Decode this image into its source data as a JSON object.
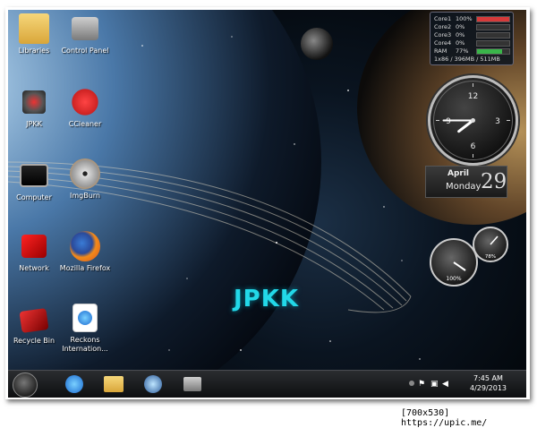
{
  "desktop_icons": [
    {
      "label": "Libraries",
      "icon": "folder-icon"
    },
    {
      "label": "Control Panel",
      "icon": "control-panel-icon"
    },
    {
      "label": "JPKK",
      "icon": "jpkk-app-icon"
    },
    {
      "label": "CCleaner",
      "icon": "ccleaner-icon"
    },
    {
      "label": "Computer",
      "icon": "computer-icon"
    },
    {
      "label": "ImgBurn",
      "icon": "imgburn-icon"
    },
    {
      "label": "Network",
      "icon": "network-icon"
    },
    {
      "label": "Mozilla Firefox",
      "icon": "firefox-icon"
    },
    {
      "label": "Recycle Bin",
      "icon": "recycle-bin-icon"
    },
    {
      "label": "Reckons Internation...",
      "icon": "internet-explorer-shortcut-icon"
    }
  ],
  "wallpaper_text": "JPKK",
  "cpu_gadget": {
    "rows": [
      {
        "name": "Core1",
        "value": "100%",
        "level": 1.0,
        "color": "#d63a3a"
      },
      {
        "name": "Core2",
        "value": "0%",
        "level": 0.0,
        "color": "#3ab54a"
      },
      {
        "name": "Core3",
        "value": "0%",
        "level": 0.0,
        "color": "#3ab54a"
      },
      {
        "name": "Core4",
        "value": "0%",
        "level": 0.0,
        "color": "#3ab54a"
      },
      {
        "name": "RAM",
        "value": "77%",
        "level": 0.77,
        "color": "#3ab54a"
      }
    ],
    "footer": "1x86 / 396MB / 511MB"
  },
  "clock_gadget": {
    "numerals": [
      "12",
      "3",
      "6",
      "9"
    ],
    "time_hours": 7,
    "time_minutes": 45
  },
  "calendar_gadget": {
    "month": "April",
    "weekday": "Monday",
    "day": "29"
  },
  "meter_gadget": {
    "cpu_value": "100%",
    "ram_value": "78%"
  },
  "taskbar": {
    "pinned": [
      "internet-explorer-icon",
      "explorer-folder-icon",
      "media-player-icon",
      "control-panel-icon"
    ],
    "time": "7:45 AM",
    "date": "4/29/2013"
  },
  "watermark": "[700x530] https://upic.me/"
}
